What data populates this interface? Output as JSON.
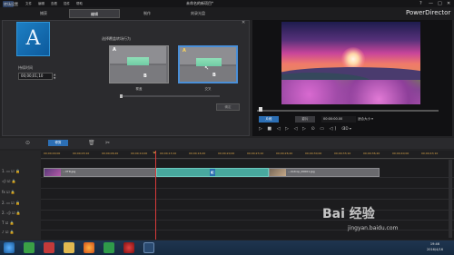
{
  "window": {
    "title": "未命名的新项目*",
    "brand": "PowerDirector",
    "menus": [
      "文件",
      "编辑",
      "查看",
      "插件",
      "帮助"
    ],
    "controls": [
      "?",
      "—",
      "□",
      "✕"
    ]
  },
  "tabs": [
    "捕获",
    "编辑",
    "制作",
    "刻录光盘"
  ],
  "active_tab": "编辑",
  "transition_panel": {
    "title": "转场设置",
    "close": "✕",
    "preview_letter": "A",
    "duration_label": "持续时间",
    "duration_value": "00;00;01;10",
    "mode_label": "选择覆盖转场行为",
    "modes": [
      {
        "caption": "覆盖",
        "letter_a": "A",
        "letter_b": "B"
      },
      {
        "caption": "交叉",
        "letter_a": "A",
        "letter_b": "B"
      }
    ],
    "selected_mode": "交叉",
    "ok_label": "确定"
  },
  "preview": {
    "mode_clip": "片段",
    "mode_movie": "影片",
    "timecode": "00:00:00.00",
    "fit": "适合大小 ▾",
    "controls": "▷ ■ ◁ ▷ ◁ ▷ ⊙ ▭ ◁) ⊙",
    "ctrl_3d": "3D ▾"
  },
  "timeline": {
    "edit_btn": "修剪",
    "ticks": [
      "00;00;00;00",
      "00;00;03;10",
      "00;00;06;20",
      "00;00;10;00",
      "00;00;13;10",
      "00;00;16;20",
      "00;00;20;00",
      "00;00;23;10",
      "00;00;26;20",
      "00;00;30;00",
      "00;00;33;10",
      "00;00;36;20",
      "00;00;40;00",
      "00;00;43;10"
    ],
    "track_heads": [
      "1.",
      "",
      "fx",
      "2.",
      "2.",
      "T",
      "♪"
    ],
    "clip1_name": "...VTR.jpg",
    "clip2_name": "...ckdrop_00001.jpg"
  },
  "taskbar": {
    "time": "19:46",
    "date": "2016/4/16"
  },
  "watermark": {
    "main": "Bai 经验",
    "sub": "jingyan.baidu.com"
  }
}
